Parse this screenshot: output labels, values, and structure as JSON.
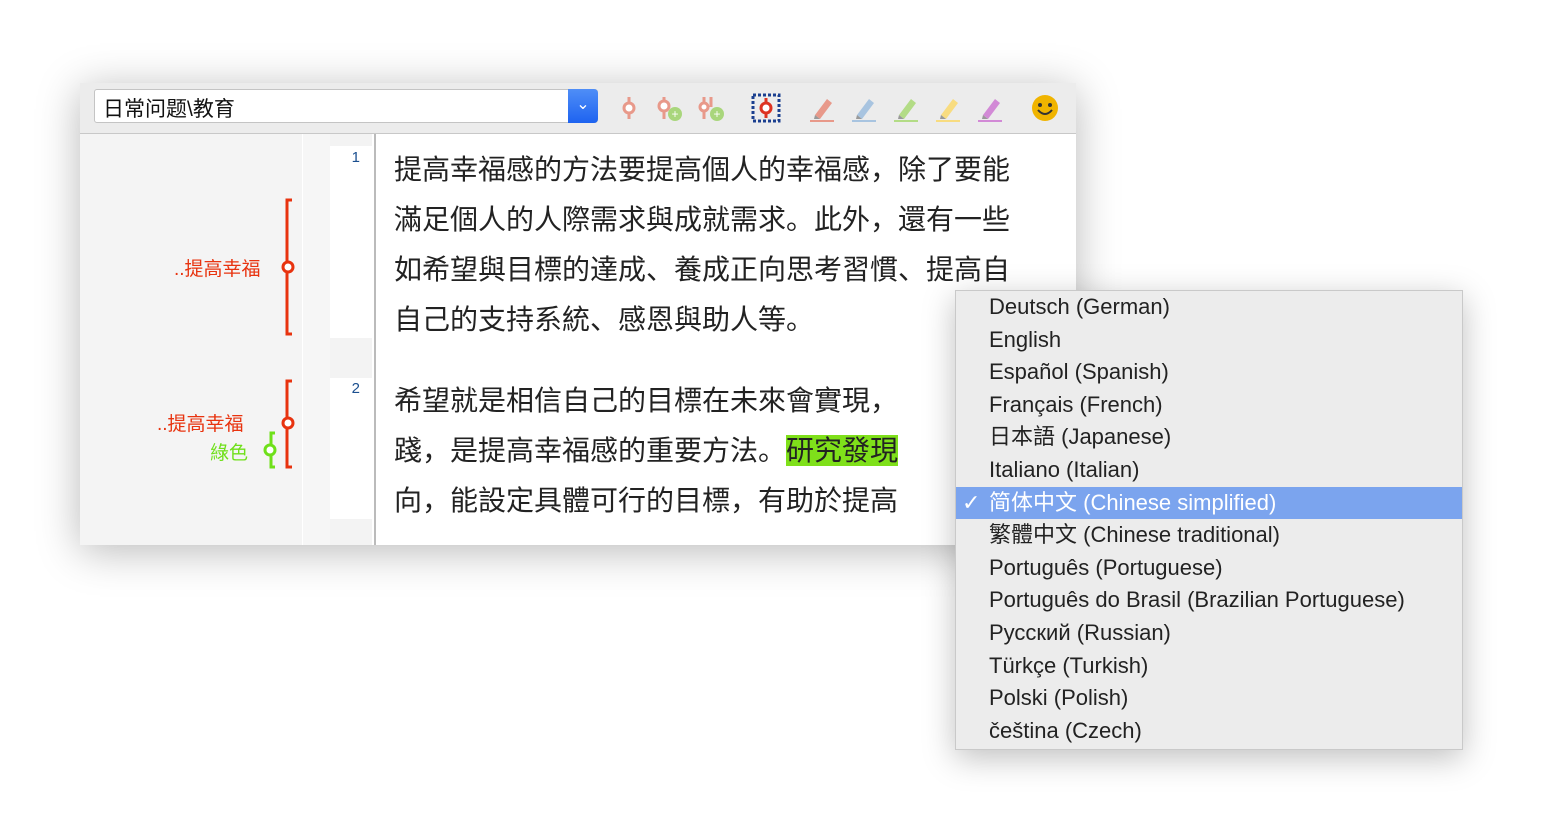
{
  "toolbar": {
    "combo_value": "日常问题\\教育",
    "icons": [
      "code-icon",
      "add-code-icon",
      "add-subcode-icon",
      "select-code-icon",
      "highlight-red-icon",
      "highlight-blue-icon",
      "highlight-green-icon",
      "highlight-yellow-icon",
      "highlight-magenta-icon",
      "emoticon-icon"
    ]
  },
  "codes": [
    {
      "label": "..提高幸福",
      "color": "#e8330f"
    },
    {
      "label": "..提高幸福",
      "color": "#e8330f"
    },
    {
      "label": "綠色",
      "color": "#6fe01a"
    }
  ],
  "paragraphs": [
    {
      "number": "1",
      "lines": [
        "提高幸福感的方法要提高個人的幸福感，除了要能",
        "滿足個人的人際需求與成就需求。此外，還有一些",
        "如希望與目標的達成、養成正向思考習慣、提高自",
        "自己的支持系統、感恩與助人等。"
      ]
    },
    {
      "number": "2",
      "lines": [
        "希望就是相信自己的目標在未來會實現，",
        "踐，是提高幸福感的重要方法。",
        "向，能設定具體可行的目標，有助於提高"
      ],
      "highlight": "研究發現"
    }
  ],
  "menu": {
    "selected_index": 6,
    "items": [
      "Deutsch (German)",
      "English",
      "Español (Spanish)",
      "Français (French)",
      "日本語 (Japanese)",
      "Italiano (Italian)",
      "简体中文 (Chinese simplified)",
      "繁體中文 (Chinese traditional)",
      "Português (Portuguese)",
      "Português do Brasil (Brazilian Portuguese)",
      "Русский (Russian)",
      "Türkçe (Turkish)",
      "Polski (Polish)",
      "čeština (Czech)"
    ],
    "check": "✓"
  }
}
